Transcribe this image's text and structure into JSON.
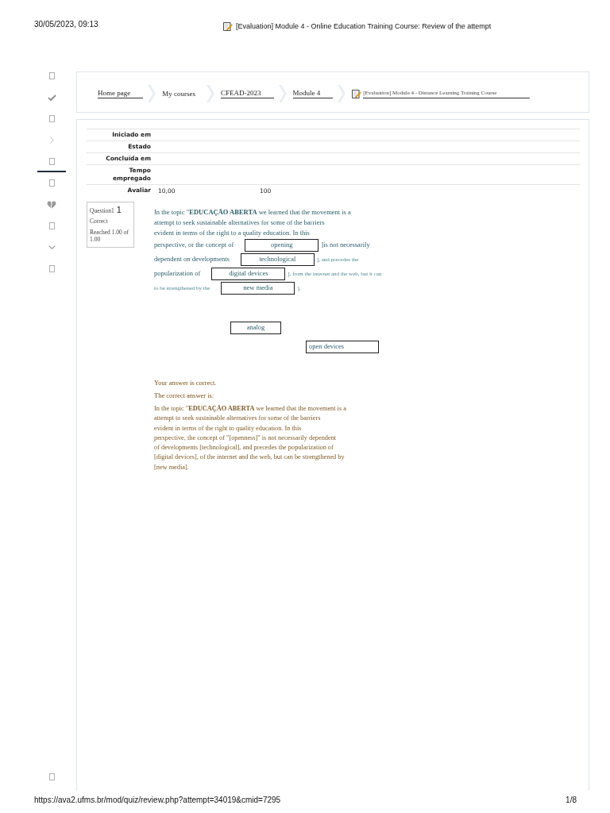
{
  "header": {
    "date": "30/05/2023, 09:13",
    "title": "[Evaluation] Module 4 - Online Education Training Course: Review of the attempt"
  },
  "sidebar": {
    "items": [
      {
        "kind": "box",
        "selected": false
      },
      {
        "kind": "check",
        "selected": false
      },
      {
        "kind": "box",
        "selected": false
      },
      {
        "kind": "chevron-right",
        "selected": false
      },
      {
        "kind": "box",
        "selected": true
      },
      {
        "kind": "box",
        "selected": false
      },
      {
        "kind": "heart",
        "selected": false
      },
      {
        "kind": "box",
        "selected": false
      },
      {
        "kind": "chevron-down",
        "selected": false
      },
      {
        "kind": "box",
        "selected": false
      }
    ],
    "bottom_items": [
      {
        "kind": "box"
      }
    ]
  },
  "breadcrumb": [
    {
      "kind": "page",
      "label": "Home page",
      "link": true
    },
    {
      "kind": "page",
      "label": "My courses",
      "link": false
    },
    {
      "kind": "page",
      "label": "CFEAD-2023",
      "link": true
    },
    {
      "kind": "page",
      "label": "Module 4",
      "link": true
    },
    {
      "kind": "quiz",
      "label": "[Evaluation] Module 4 - Distance Learning Training Course",
      "link": true
    }
  ],
  "summary": {
    "rows": [
      {
        "label": "Iniciado em"
      },
      {
        "label": "Estado"
      },
      {
        "label": "Concluída em"
      },
      {
        "label": "Tempo empregado"
      },
      {
        "label": "Avaliar",
        "values": [
          "10,00",
          "100"
        ]
      }
    ]
  },
  "question": {
    "info": {
      "title": "Question1",
      "number": "1",
      "status": "Correct",
      "grade": "Reached 1.00 of 1.00"
    },
    "lines": [
      [
        {
          "kind": "text",
          "text": "In the topic \"**EDUCAÇÃO ABERTA** we learned that the movement is a"
        }
      ],
      [
        {
          "kind": "text",
          "text": "attempt to seek sustainable alternatives for some of the barriers"
        }
      ],
      [
        {
          "kind": "text",
          "text": "evident in terms of the right to a quality education. In this"
        }
      ],
      [
        {
          "kind": "text",
          "text": "perspective, or the concept of"
        },
        {
          "kind": "drop",
          "text": "opening"
        },
        {
          "kind": "text",
          "text": "]is not necessarily"
        }
      ],
      [
        {
          "kind": "text",
          "text": "dependent on developments"
        },
        {
          "kind": "drop",
          "text": "technological"
        },
        {
          "kind": "small",
          "text": "], and precedes the"
        }
      ],
      [
        {
          "kind": "text",
          "text": "popularization of"
        },
        {
          "kind": "drop",
          "text": "digital devices"
        },
        {
          "kind": "small",
          "text": "], from the internet and the web, but it can"
        }
      ],
      [
        {
          "kind": "small",
          "text": "to be strengthened by the"
        },
        {
          "kind": "drop",
          "text": "new media"
        },
        {
          "kind": "small",
          "text": "]."
        }
      ]
    ],
    "choices": [
      "analog",
      "open devices"
    ],
    "feedback": {
      "result": "Your answer is correct.",
      "answer_label": "The correct answer is:",
      "answer_lines": [
        "In the topic \"**EDUCAÇÃO ABERTA** we learned that the movement is a",
        "attempt to seek sustainable alternatives for some of the barriers",
        "evident in terms of the right to quality education. In this",
        "perspective, the concept of \"[openness]\" is not necessarily dependent",
        "of developments [technological], and precedes the popularization of",
        "[digital devices], of the internet and the web, but can be strengthened by",
        "[new media]."
      ]
    }
  },
  "footer": {
    "url": "https://ava2.ufms.br/mod/quiz/review.php?attempt=34019&cmid=7295",
    "page": "1/8"
  }
}
